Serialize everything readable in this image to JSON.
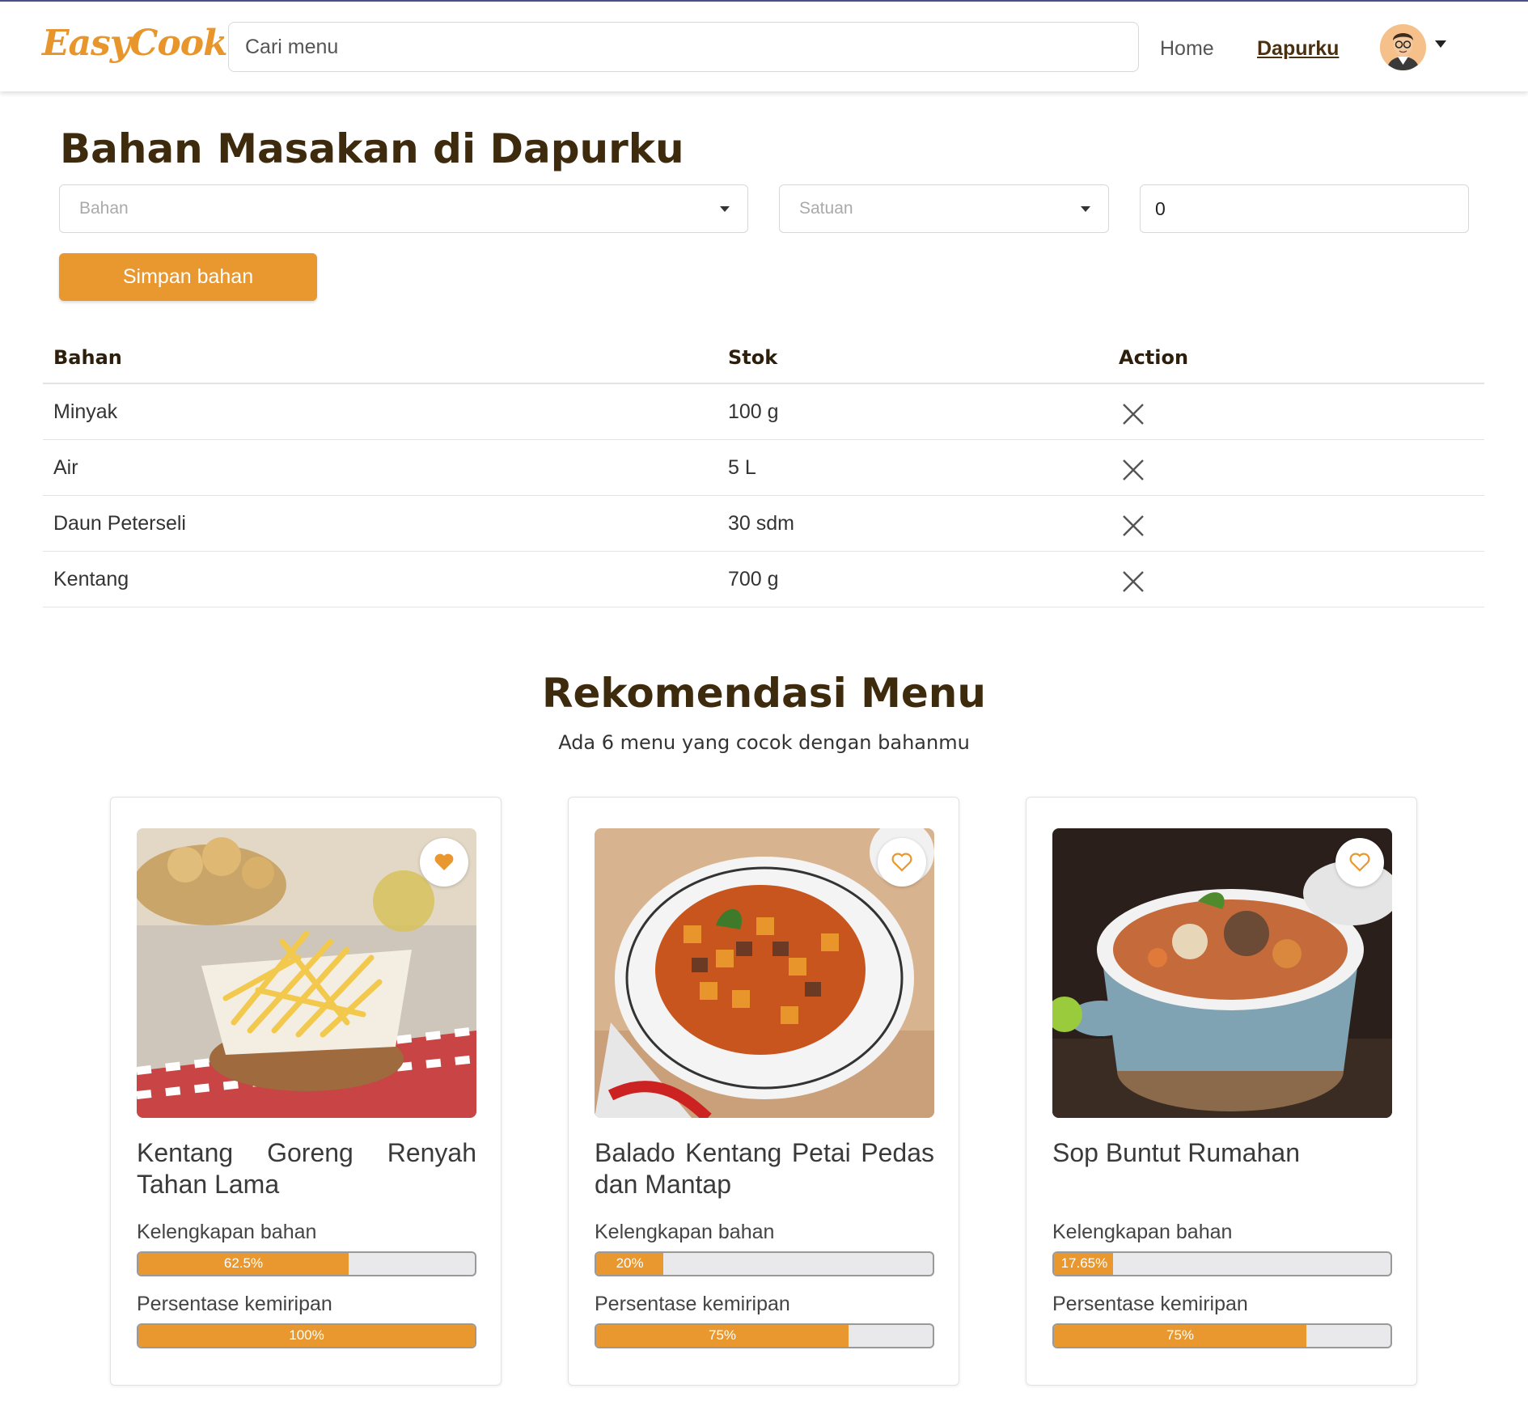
{
  "navbar": {
    "logo": "EasyCook",
    "search_placeholder": "Cari menu",
    "links": {
      "home": "Home",
      "dapurku": "Dapurku"
    }
  },
  "kitchen": {
    "title": "Bahan Masakan di Dapurku",
    "bahan_placeholder": "Bahan",
    "satuan_placeholder": "Satuan",
    "qty_value": "0",
    "save_label": "Simpan bahan",
    "table": {
      "headers": [
        "Bahan",
        "Stok",
        "Action"
      ],
      "rows": [
        {
          "bahan": "Minyak",
          "stok": "100 g"
        },
        {
          "bahan": "Air",
          "stok": "5 L"
        },
        {
          "bahan": "Daun Peterseli",
          "stok": "30 sdm"
        },
        {
          "bahan": "Kentang",
          "stok": "700 g"
        }
      ]
    }
  },
  "recommend": {
    "title": "Rekomendasi Menu",
    "subtitle": "Ada 6 menu yang cocok dengan bahanmu",
    "cards": [
      {
        "title": "Kentang Goreng Renyah Tahan Lama",
        "favorited": true,
        "kelengkapan_label": "Kelengkapan bahan",
        "kelengkapan_text": "62.5%",
        "kelengkapan_value": 62.5,
        "kemiripan_label": "Persentase kemiripan",
        "kemiripan_text": "100%",
        "kemiripan_value": 100
      },
      {
        "title": "Balado Kentang Petai Pedas dan Mantap",
        "favorited": false,
        "kelengkapan_label": "Kelengkapan bahan",
        "kelengkapan_text": "20%",
        "kelengkapan_value": 20,
        "kemiripan_label": "Persentase kemiripan",
        "kemiripan_text": "75%",
        "kemiripan_value": 75
      },
      {
        "title": "Sop Buntut Rumahan",
        "favorited": false,
        "kelengkapan_label": "Kelengkapan bahan",
        "kelengkapan_text": "17.65%",
        "kelengkapan_value": 17.65,
        "kemiripan_label": "Persentase kemiripan",
        "kemiripan_text": "75%",
        "kemiripan_value": 75
      }
    ]
  },
  "colors": {
    "accent": "#e8982f",
    "heading": "#3e2a0c"
  }
}
